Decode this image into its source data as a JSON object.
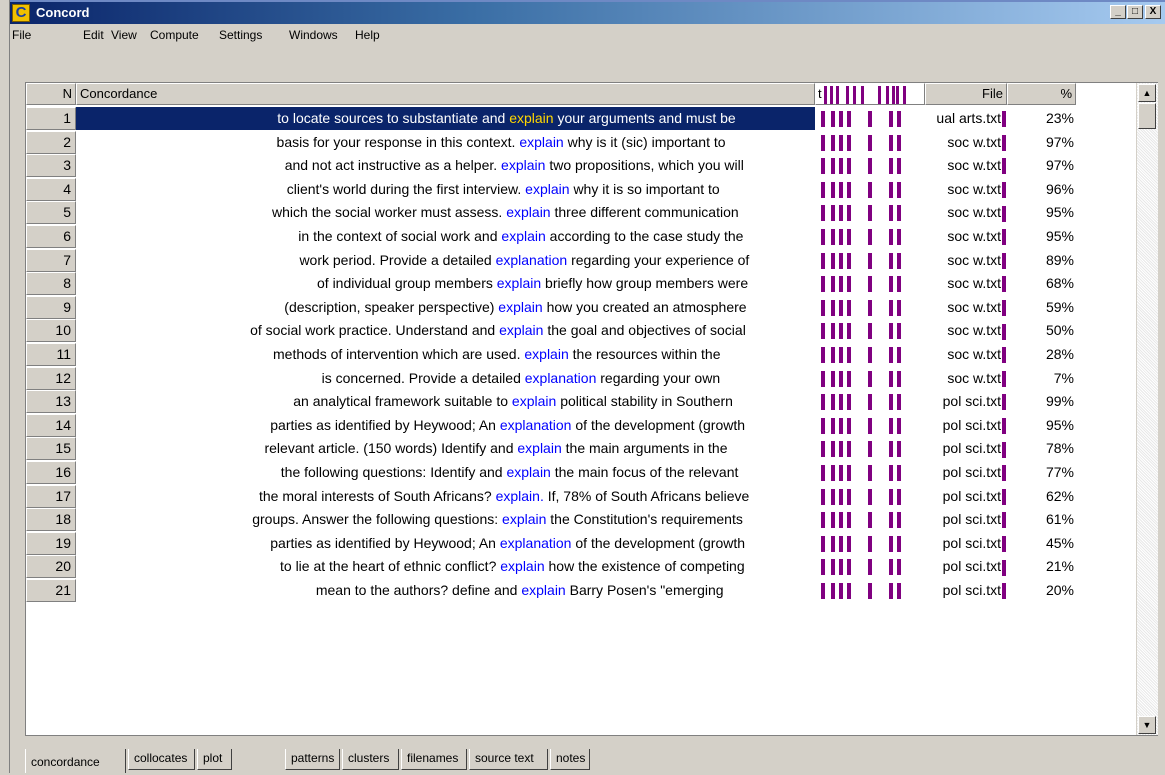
{
  "window": {
    "title": "Concord",
    "app_icon_letter": "C",
    "minimize_glyph": "_",
    "maximize_glyph": "□",
    "close_glyph": "X"
  },
  "menu": {
    "file": "File",
    "items": [
      "Edit",
      "View",
      "Compute",
      "Settings",
      "Windows",
      "Help"
    ]
  },
  "columns": {
    "n": "N",
    "concordance": "Concordance",
    "plot_header": "t",
    "file": "File",
    "percent": "%"
  },
  "colors": {
    "keyword": "#0000ff",
    "selection_bg": "#0a246a",
    "selection_keyword": "#ffd700",
    "plot_mark": "#800080"
  },
  "rows": [
    {
      "n": "1",
      "left": "to locate sources to substantiate and",
      "kw": "explain",
      "right": "your arguments and must be",
      "file": "ual arts.txt",
      "pct": "23%",
      "selected": true
    },
    {
      "n": "2",
      "left": "basis for your response in this context.",
      "kw": "explain",
      "right": "why is it (sic) important to",
      "file": "soc w.txt",
      "pct": "97%"
    },
    {
      "n": "3",
      "left": "and not act instructive as a helper.",
      "kw": "explain",
      "right": "two propositions, which you will",
      "file": "soc w.txt",
      "pct": "97%"
    },
    {
      "n": "4",
      "left": "client's world during the first interview.",
      "kw": "explain",
      "right": "why it is so important to",
      "file": "soc w.txt",
      "pct": "96%"
    },
    {
      "n": "5",
      "left": "which the social worker must assess.",
      "kw": "explain",
      "right": "three different communication",
      "file": "soc w.txt",
      "pct": "95%"
    },
    {
      "n": "6",
      "left": "in the context of social work and",
      "kw": "explain",
      "right": "according to the case study the",
      "file": "soc w.txt",
      "pct": "95%"
    },
    {
      "n": "7",
      "left": "work period. Provide a detailed",
      "kw": "explanation",
      "right": "regarding your experience of",
      "file": "soc w.txt",
      "pct": "89%"
    },
    {
      "n": "8",
      "left": "of individual group members",
      "kw": "explain",
      "right": "briefly how group members were",
      "file": "soc w.txt",
      "pct": "68%"
    },
    {
      "n": "9",
      "left": "(description, speaker perspective)",
      "kw": "explain",
      "right": "how you created an atmosphere",
      "file": "soc w.txt",
      "pct": "59%"
    },
    {
      "n": "10",
      "left": "of social work practice. Understand and",
      "kw": "explain",
      "right": "the goal and objectives of social",
      "file": "soc w.txt",
      "pct": "50%"
    },
    {
      "n": "11",
      "left": "methods of intervention which are used.",
      "kw": "explain",
      "right": "the resources within the",
      "file": "soc w.txt",
      "pct": "28%"
    },
    {
      "n": "12",
      "left": "is concerned. Provide a detailed",
      "kw": "explanation",
      "right": "regarding your own",
      "file": "soc w.txt",
      "pct": "7%"
    },
    {
      "n": "13",
      "left": "an analytical framework suitable to",
      "kw": "explain",
      "right": "political stability in Southern",
      "file": "pol sci.txt",
      "pct": "99%"
    },
    {
      "n": "14",
      "left": "parties as identified by Heywood; An",
      "kw": "explanation",
      "right": "of the development (growth",
      "file": "pol sci.txt",
      "pct": "95%"
    },
    {
      "n": "15",
      "left": "relevant article. (150 words) Identify and",
      "kw": "explain",
      "right": "the main arguments in the",
      "file": "pol sci.txt",
      "pct": "78%"
    },
    {
      "n": "16",
      "left": "the following questions: Identify and",
      "kw": "explain",
      "right": "the main focus of the relevant",
      "file": "pol sci.txt",
      "pct": "77%"
    },
    {
      "n": "17",
      "left": "the moral interests of South Africans?",
      "kw": "explain.",
      "right": "If, 78% of South Africans believe",
      "file": "pol sci.txt",
      "pct": "62%"
    },
    {
      "n": "18",
      "left": "groups. Answer the following questions:",
      "kw": "explain",
      "right": "the Constitution's requirements",
      "file": "pol sci.txt",
      "pct": "61%"
    },
    {
      "n": "19",
      "left": "parties as identified by Heywood; An",
      "kw": "explanation",
      "right": "of the development (growth",
      "file": "pol sci.txt",
      "pct": "45%"
    },
    {
      "n": "20",
      "left": "to lie at the heart of ethnic conflict?",
      "kw": "explain",
      "right": "how the existence of competing",
      "file": "pol sci.txt",
      "pct": "21%"
    },
    {
      "n": "21",
      "left": "mean to the authors? define and",
      "kw": "explain",
      "right": "Barry Posen's \"emerging",
      "file": "pol sci.txt",
      "pct": "20%"
    }
  ],
  "tabs": [
    "concordance",
    "collocates",
    "plot",
    "patterns",
    "clusters",
    "filenames",
    "source text",
    "notes"
  ],
  "active_tab": "concordance"
}
